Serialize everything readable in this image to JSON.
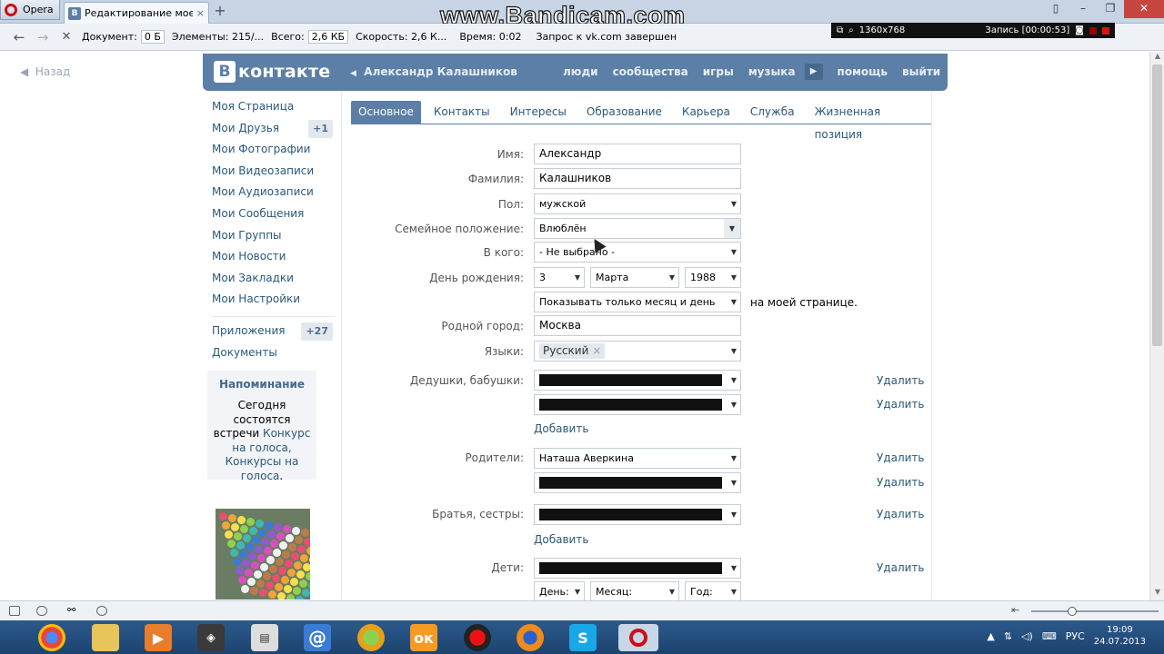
{
  "browser": {
    "menu_label": "Opera",
    "tab_title": "Редактирование моей...",
    "tab_close": "×",
    "new_tab": "+",
    "watermark": "www.Bandicam.com",
    "stats": {
      "document_label": "Документ:",
      "document_value": "0 Б",
      "elements_label": "Элементы:",
      "elements_value": "215/...",
      "total_label": "Всего:",
      "total_value": "2,6 КБ",
      "speed_label": "Скорость:",
      "speed_value": "2,6 К...",
      "time_label": "Время:",
      "time_value": "0:02",
      "status": "Запрос к vk.com завершен"
    },
    "recorder": {
      "resolution": "1360x768",
      "recording": "Запись [00:00:53]"
    }
  },
  "page": {
    "back_label": "Назад",
    "logo_letter": "В",
    "logo_text": "контакте",
    "user_name": "Александр Калашников",
    "nav": {
      "people": "люди",
      "communities": "сообщества",
      "games": "игры",
      "music": "музыка",
      "help": "помощь",
      "logout": "выйти"
    },
    "sidebar": {
      "items": [
        {
          "label": "Моя Страница",
          "badge": ""
        },
        {
          "label": "Мои Друзья",
          "badge": "+1"
        },
        {
          "label": "Мои Фотографии",
          "badge": ""
        },
        {
          "label": "Мои Видеозаписи",
          "badge": ""
        },
        {
          "label": "Мои Аудиозаписи",
          "badge": ""
        },
        {
          "label": "Мои Сообщения",
          "badge": ""
        },
        {
          "label": "Мои Группы",
          "badge": ""
        },
        {
          "label": "Мои Новости",
          "badge": ""
        },
        {
          "label": "Мои Закладки",
          "badge": ""
        },
        {
          "label": "Мои Настройки",
          "badge": ""
        }
      ],
      "apps": {
        "label": "Приложения",
        "badge": "+27"
      },
      "docs": {
        "label": "Документы"
      }
    },
    "reminder": {
      "title": "Напоминание",
      "text1": "Сегодня",
      "text2": "состоятся встречи",
      "link1": "Конкурс на голоса,",
      "link2": "Конкурсы на голоса",
      "dot": "."
    },
    "tabs": [
      "Основное",
      "Контакты",
      "Интересы",
      "Образование",
      "Карьера",
      "Служба",
      "Жизненная позиция"
    ],
    "form": {
      "first_name_label": "Имя:",
      "first_name": "Александр",
      "last_name_label": "Фамилия:",
      "last_name": "Калашников",
      "gender_label": "Пол:",
      "gender": "мужской",
      "relationship_label": "Семейное положение:",
      "relationship": "Влюблён",
      "partner_label": "В кого:",
      "partner": "- Не выбрано -",
      "birthday_label": "День рождения:",
      "birth_day": "3",
      "birth_month": "Марта",
      "birth_year": "1988",
      "birthday_visibility": "Показывать  только  месяц  и  день",
      "birthday_visibility_suffix": "на моей странице.",
      "hometown_label": "Родной город:",
      "hometown": "Москва",
      "languages_label": "Языки:",
      "language_tag": "Русский",
      "tag_remove": "×",
      "grandparents_label": "Дедушки, бабушки:",
      "parents_label": "Родители:",
      "parent1": "Наташа  Аверкина",
      "siblings_label": "Братья, сестры:",
      "children_label": "Дети:",
      "child_day": "День:",
      "child_month": "Месяц:",
      "child_year": "Год:",
      "remove": "Удалить",
      "add": "Добавить"
    }
  },
  "taskbar": {
    "lang": "РУС",
    "time": "19:09",
    "date": "24.07.2013"
  }
}
